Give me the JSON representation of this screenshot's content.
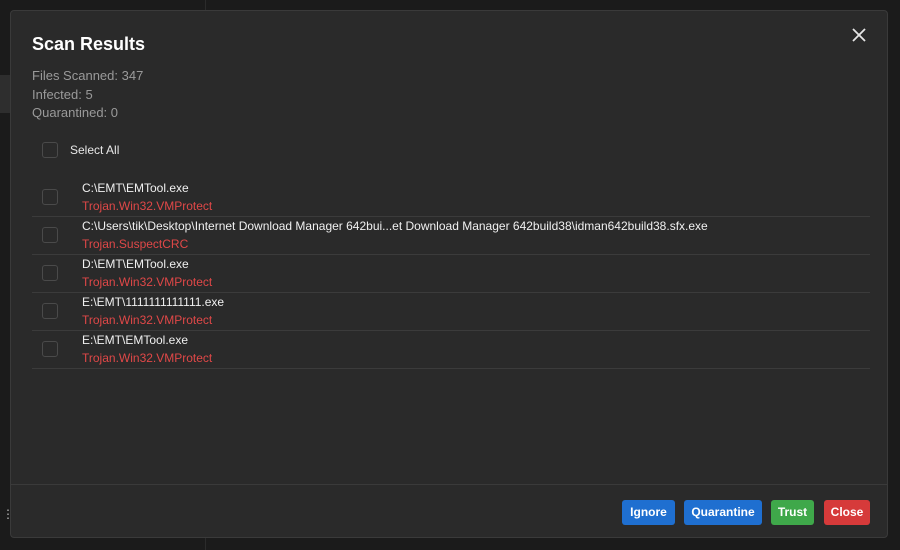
{
  "dialog": {
    "title": "Scan Results",
    "stats": {
      "files_scanned": "Files Scanned: 347",
      "infected": "Infected: 5",
      "quarantined": "Quarantined: 0"
    },
    "select_all_label": "Select All",
    "results": [
      {
        "path": "C:\\EMT\\EMTool.exe",
        "threat": "Trojan.Win32.VMProtect"
      },
      {
        "path": "C:\\Users\\tik\\Desktop\\Internet Download Manager 642bui...et Download Manager 642build38\\idman642build38.sfx.exe",
        "threat": "Trojan.SuspectCRC"
      },
      {
        "path": "D:\\EMT\\EMTool.exe",
        "threat": "Trojan.Win32.VMProtect"
      },
      {
        "path": "E:\\EMT\\1111111111111.exe",
        "threat": "Trojan.Win32.VMProtect"
      },
      {
        "path": "E:\\EMT\\EMTool.exe",
        "threat": "Trojan.Win32.VMProtect"
      }
    ],
    "buttons": {
      "ignore": "Ignore",
      "quarantine": "Quarantine",
      "trust": "Trust",
      "close": "Close"
    }
  },
  "colors": {
    "threat": "#e04848",
    "primary": "#1f6fd0",
    "success": "#3fa84a",
    "danger": "#d63a3a"
  },
  "icons": {
    "close": "close-icon",
    "menu": "menu-icon"
  }
}
